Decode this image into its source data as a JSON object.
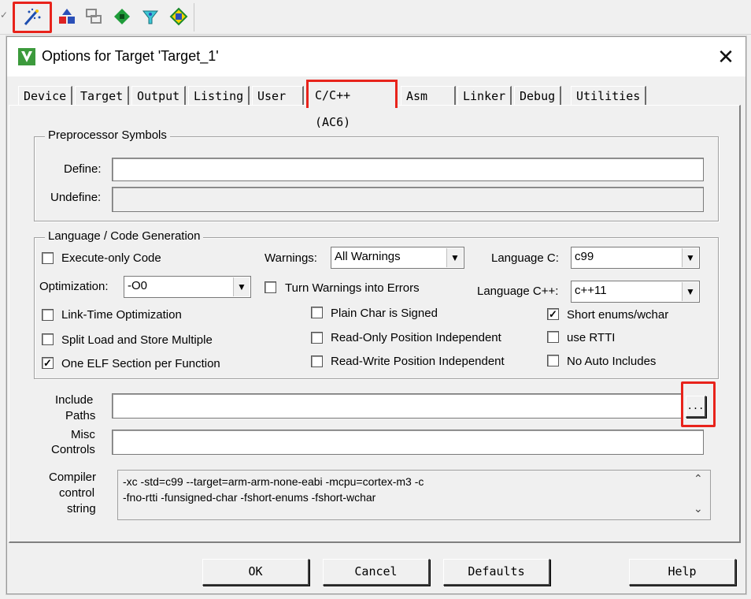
{
  "toolbar": {
    "icons": [
      "options-for-target-icon",
      "load-icon",
      "copy-icon",
      "manage-components-icon",
      "select-software-packs-icon",
      "pack-installer-icon"
    ]
  },
  "dialog": {
    "title": "Options for Target 'Target_1'",
    "close": "✕"
  },
  "tabs": [
    "Device",
    "Target",
    "Output",
    "Listing",
    "User",
    "C/C++ (AC6)",
    "Asm",
    "Linker",
    "Debug",
    "Utilities"
  ],
  "preprocessor": {
    "legend": "Preprocessor Symbols",
    "define_label": "Define:",
    "define_value": "",
    "undefine_label": "Undefine:",
    "undefine_value": ""
  },
  "language": {
    "legend": "Language / Code Generation",
    "execute_only": "Execute-only Code",
    "optimization_label": "Optimization:",
    "optimization_value": "-O0",
    "link_time": "Link-Time Optimization",
    "split_load": "Split Load and Store Multiple",
    "one_elf": "One ELF Section per Function",
    "warnings_label": "Warnings:",
    "warnings_value": "All Warnings",
    "turn_warnings": "Turn Warnings into Errors",
    "plain_char": "Plain Char is Signed",
    "ro_pi": "Read-Only Position Independent",
    "rw_pi": "Read-Write Position Independent",
    "lang_c_label": "Language C:",
    "lang_c_value": "c99",
    "lang_cpp_label": "Language C++:",
    "lang_cpp_value": "c++11",
    "short_enums": "Short enums/wchar",
    "use_rtti": "use RTTI",
    "no_auto": "No Auto Includes"
  },
  "paths": {
    "include_label_1": "Include",
    "include_label_2": "Paths",
    "include_value": "",
    "browse": "...",
    "misc_label_1": "Misc",
    "misc_label_2": "Controls",
    "misc_value": "",
    "compiler_label_1": "Compiler",
    "compiler_label_2": "control",
    "compiler_label_3": "string",
    "compiler_line_1": "-xc -std=c99 --target=arm-arm-none-eabi -mcpu=cortex-m3 -c",
    "compiler_line_2": "-fno-rtti -funsigned-char -fshort-enums -fshort-wchar"
  },
  "buttons": {
    "ok": "OK",
    "cancel": "Cancel",
    "defaults": "Defaults",
    "help": "Help"
  },
  "colors": {
    "highlight": "#e8231b"
  }
}
